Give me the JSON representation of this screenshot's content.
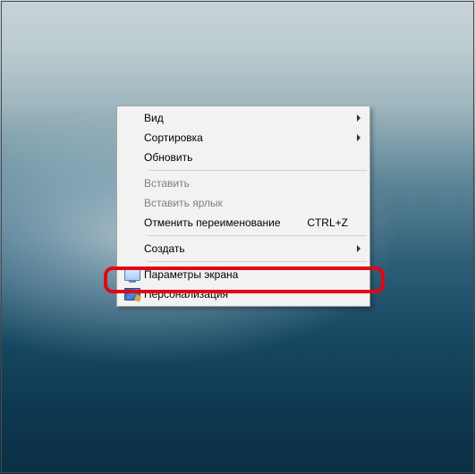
{
  "context_menu": {
    "view": {
      "label": "Вид",
      "has_submenu": true
    },
    "sort": {
      "label": "Сортировка",
      "has_submenu": true
    },
    "refresh": {
      "label": "Обновить"
    },
    "paste": {
      "label": "Вставить",
      "disabled": true
    },
    "paste_shortcut": {
      "label": "Вставить ярлык",
      "disabled": true
    },
    "undo": {
      "label": "Отменить переименование",
      "shortcut": "CTRL+Z"
    },
    "new": {
      "label": "Создать",
      "has_submenu": true
    },
    "display_settings": {
      "label": "Параметры экрана",
      "icon": "monitor-icon"
    },
    "personalize": {
      "label": "Персонализация",
      "icon": "personalize-icon"
    }
  },
  "highlight_target": "display_settings"
}
